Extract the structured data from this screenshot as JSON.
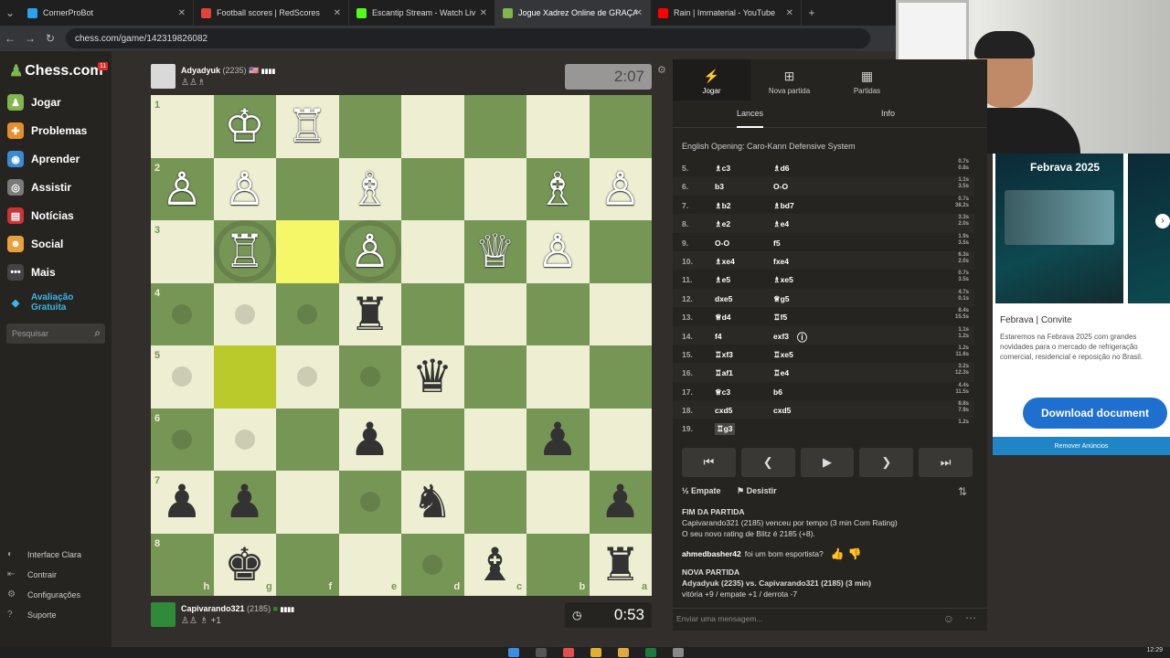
{
  "browser": {
    "tabs": [
      {
        "title": "CornerProBot",
        "color": "#2aa3ef",
        "active": false
      },
      {
        "title": "Football scores | RedScores",
        "color": "#e0443a",
        "active": false
      },
      {
        "title": "Escantip Stream - Watch Liv",
        "color": "#53fc18",
        "active": false
      },
      {
        "title": "Jogue Xadrez Online de GRAÇA",
        "color": "#81b64c",
        "active": true
      },
      {
        "title": "Rain | Immaterial - YouTube",
        "color": "#ff0000",
        "active": false
      }
    ],
    "new_tab": "+",
    "url": "chess.com/game/142319826082"
  },
  "sidebar": {
    "logo": "Chess.com",
    "notif_count": "11",
    "items": [
      {
        "label": "Jogar",
        "color": "#81b64c",
        "icon": "♟"
      },
      {
        "label": "Problemas",
        "color": "#e58f2a",
        "icon": "✚"
      },
      {
        "label": "Aprender",
        "color": "#3b8ad3",
        "icon": "◉"
      },
      {
        "label": "Assistir",
        "color": "#7a7a7a",
        "icon": "◎"
      },
      {
        "label": "Notícias",
        "color": "#c33",
        "icon": "▤"
      },
      {
        "label": "Social",
        "color": "#e9a23b",
        "icon": "☻"
      },
      {
        "label": "Mais",
        "color": "#444",
        "icon": "•••"
      }
    ],
    "upgrade": "Avaliação Gratuita",
    "search_placeholder": "Pesquisar",
    "footer": [
      "Interface Clara",
      "Contrair",
      "Configurações",
      "Suporte"
    ]
  },
  "top_player": {
    "name": "Adyadyuk",
    "rating": "(2235)",
    "captured": "♙♙♗",
    "clock": "2:07",
    "flag_bars": "▮▮▮▮"
  },
  "bottom_player": {
    "name": "Capivarando321",
    "rating": "(2185)",
    "captured": "♙♙ ♗ +1",
    "clock": "0:53",
    "flag_bars": "▮▮▮▮"
  },
  "board": {
    "ranks": [
      "1",
      "2",
      "3",
      "4",
      "5",
      "6",
      "7",
      "8"
    ],
    "files": [
      "h",
      "g",
      "f",
      "e",
      "d",
      "c",
      "b",
      "a"
    ],
    "pieces": [
      {
        "sq": "g1",
        "p": "♔",
        "c": "w"
      },
      {
        "sq": "f1",
        "p": "♖",
        "c": "w"
      },
      {
        "sq": "h2",
        "p": "♙",
        "c": "w"
      },
      {
        "sq": "g2",
        "p": "♙",
        "c": "w"
      },
      {
        "sq": "e2",
        "p": "♗",
        "c": "w"
      },
      {
        "sq": "b2",
        "p": "♗",
        "c": "w"
      },
      {
        "sq": "a2",
        "p": "♙",
        "c": "w"
      },
      {
        "sq": "g3",
        "p": "♖",
        "c": "w"
      },
      {
        "sq": "e3",
        "p": "♙",
        "c": "w"
      },
      {
        "sq": "c3",
        "p": "♕",
        "c": "w"
      },
      {
        "sq": "b3",
        "p": "♙",
        "c": "w"
      },
      {
        "sq": "e4",
        "p": "♜",
        "c": "b"
      },
      {
        "sq": "d5",
        "p": "♛",
        "c": "b"
      },
      {
        "sq": "e6",
        "p": "♟",
        "c": "b"
      },
      {
        "sq": "b6",
        "p": "♟",
        "c": "b"
      },
      {
        "sq": "h7",
        "p": "♟",
        "c": "b"
      },
      {
        "sq": "g7",
        "p": "♟",
        "c": "b"
      },
      {
        "sq": "d7",
        "p": "♞",
        "c": "b"
      },
      {
        "sq": "a7",
        "p": "♟",
        "c": "b"
      },
      {
        "sq": "g8",
        "p": "♚",
        "c": "b"
      },
      {
        "sq": "c8",
        "p": "♝",
        "c": "b"
      },
      {
        "sq": "a8",
        "p": "♜",
        "c": "b"
      }
    ],
    "highlights": [
      "f3",
      "g5"
    ],
    "hints": [
      "h4",
      "g4",
      "f4",
      "h5",
      "f5",
      "e5",
      "h6",
      "g6",
      "e7",
      "d8"
    ],
    "rings": [
      "g3",
      "e3"
    ]
  },
  "panel": {
    "tabs": [
      {
        "label": "Jogar",
        "icon": "⚡"
      },
      {
        "label": "Nova partida",
        "icon": "⊞"
      },
      {
        "label": "Partidas",
        "icon": "▦"
      }
    ],
    "subtabs": [
      "Lances",
      "Info"
    ],
    "opening": "English Opening: Caro-Kann Defensive System",
    "moves": [
      {
        "n": "5.",
        "w": "♗c3",
        "b": "♗d6",
        "t": "0.7s\n0.8s",
        "bar": 10
      },
      {
        "n": "6.",
        "w": "b3",
        "b": "O-O",
        "t": "1.1s\n3.5s",
        "bar": 12
      },
      {
        "n": "7.",
        "w": "♗b2",
        "b": "♗bd7",
        "t": "0.7s\n38.2s",
        "bar": 26
      },
      {
        "n": "8.",
        "w": "♗e2",
        "b": "♗e4",
        "t": "3.3s\n2.0s",
        "bar": 14
      },
      {
        "n": "9.",
        "w": "O-O",
        "b": "f5",
        "t": "1.9s\n3.5s",
        "bar": 10
      },
      {
        "n": "10.",
        "w": "♗xe4",
        "b": "fxe4",
        "t": "6.3s\n2.0s",
        "bar": 16
      },
      {
        "n": "11.",
        "w": "♗e5",
        "b": "♗xe5",
        "t": "0.7s\n3.5s",
        "bar": 10
      },
      {
        "n": "12.",
        "w": "dxe5",
        "b": "♕g5",
        "t": "4.7s\n0.1s",
        "bar": 12
      },
      {
        "n": "13.",
        "w": "♕d4",
        "b": "♖f5",
        "t": "8.4s\n15.5s",
        "bar": 20
      },
      {
        "n": "14.",
        "w": "f4",
        "b": "exf3",
        "t": "1.1s\n1.2s",
        "bar": 8
      },
      {
        "n": "15.",
        "w": "♖xf3",
        "b": "♖xe5",
        "t": "1.2s\n11.6s",
        "bar": 18
      },
      {
        "n": "16.",
        "w": "♖af1",
        "b": "♖e4",
        "t": "3.2s\n12.3s",
        "bar": 18
      },
      {
        "n": "17.",
        "w": "♕c3",
        "b": "b6",
        "t": "4.4s\n11.5s",
        "bar": 18
      },
      {
        "n": "18.",
        "w": "cxd5",
        "b": "cxd5",
        "t": "8.8s\n7.9s",
        "bar": 16
      },
      {
        "n": "19.",
        "w": "♖g3",
        "b": "",
        "t": "1.2s",
        "bar": 6
      }
    ],
    "controls": [
      "⏮",
      "❮",
      "▶",
      "❯",
      "⏭"
    ],
    "draw": "Empate",
    "resign": "Desistir",
    "chat": {
      "end_header": "FIM DA PARTIDA",
      "end_msg": "Capivarando321 (2185) venceu por tempo (3 min Com Rating)",
      "rating_msg": "O seu novo rating de Blitz é 2185 (+8).",
      "gg_user": "ahmedbasher42",
      "gg_text": "foi um bom esportista?",
      "new_header": "NOVA PARTIDA",
      "new_players": "Adyadyuk (2235) vs. Capivarando321 (2185) (3 min)",
      "new_stats": "vitória +9 / empate +1 / derrota -7"
    },
    "chat_placeholder": "Enviar uma mensagem..."
  },
  "ad": {
    "title": "Febrava | Convite",
    "text": "Estaremos na Febrava 2025 com grandes novidades para o mercado de refrigeração comercial, residencial e reposição no Brasil.",
    "button": "Download document",
    "remove": "Remover Anúncios",
    "banner_text": "Febrava 2025"
  },
  "taskbar": {
    "time": "12:29"
  },
  "colors": {
    "light": "#eeeed2",
    "dark": "#769656",
    "highlight_light": "#f6f669",
    "highlight_dark": "#baca2b"
  }
}
